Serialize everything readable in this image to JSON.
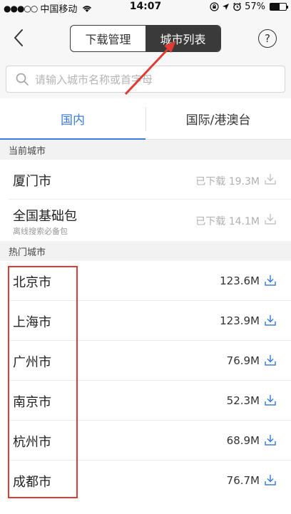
{
  "status_bar": {
    "signal": "●●●○○",
    "carrier": "中国移动",
    "wifi": "WiFi",
    "time": "14:07",
    "battery": "57%",
    "battery_level": 0.57
  },
  "nav": {
    "back_icon": "chevron-left-icon",
    "segments": [
      {
        "label": "下载管理",
        "active": false
      },
      {
        "label": "城市列表",
        "active": true
      }
    ],
    "help_label": "?"
  },
  "search": {
    "placeholder": "请输入城市名称或首字母"
  },
  "tabs": [
    {
      "label": "国内",
      "active": true
    },
    {
      "label": "国际/港澳台",
      "active": false
    }
  ],
  "current_section": {
    "title": "当前城市",
    "items": [
      {
        "name": "厦门市",
        "subtitle": "",
        "size": "已下载 19.3M",
        "downloaded": true
      },
      {
        "name": "全国基础包",
        "subtitle": "离线搜索必备包",
        "size": "已下载 14.1M",
        "downloaded": true
      }
    ]
  },
  "hot_section": {
    "title": "热门城市",
    "items": [
      {
        "name": "北京市",
        "size": "123.6M"
      },
      {
        "name": "上海市",
        "size": "123.9M"
      },
      {
        "name": "广州市",
        "size": "76.9M"
      },
      {
        "name": "南京市",
        "size": "52.3M"
      },
      {
        "name": "杭州市",
        "size": "68.9M"
      },
      {
        "name": "成都市",
        "size": "76.7M"
      }
    ]
  },
  "colors": {
    "accent": "#3b7ddd",
    "annotation": "#e03b35"
  }
}
